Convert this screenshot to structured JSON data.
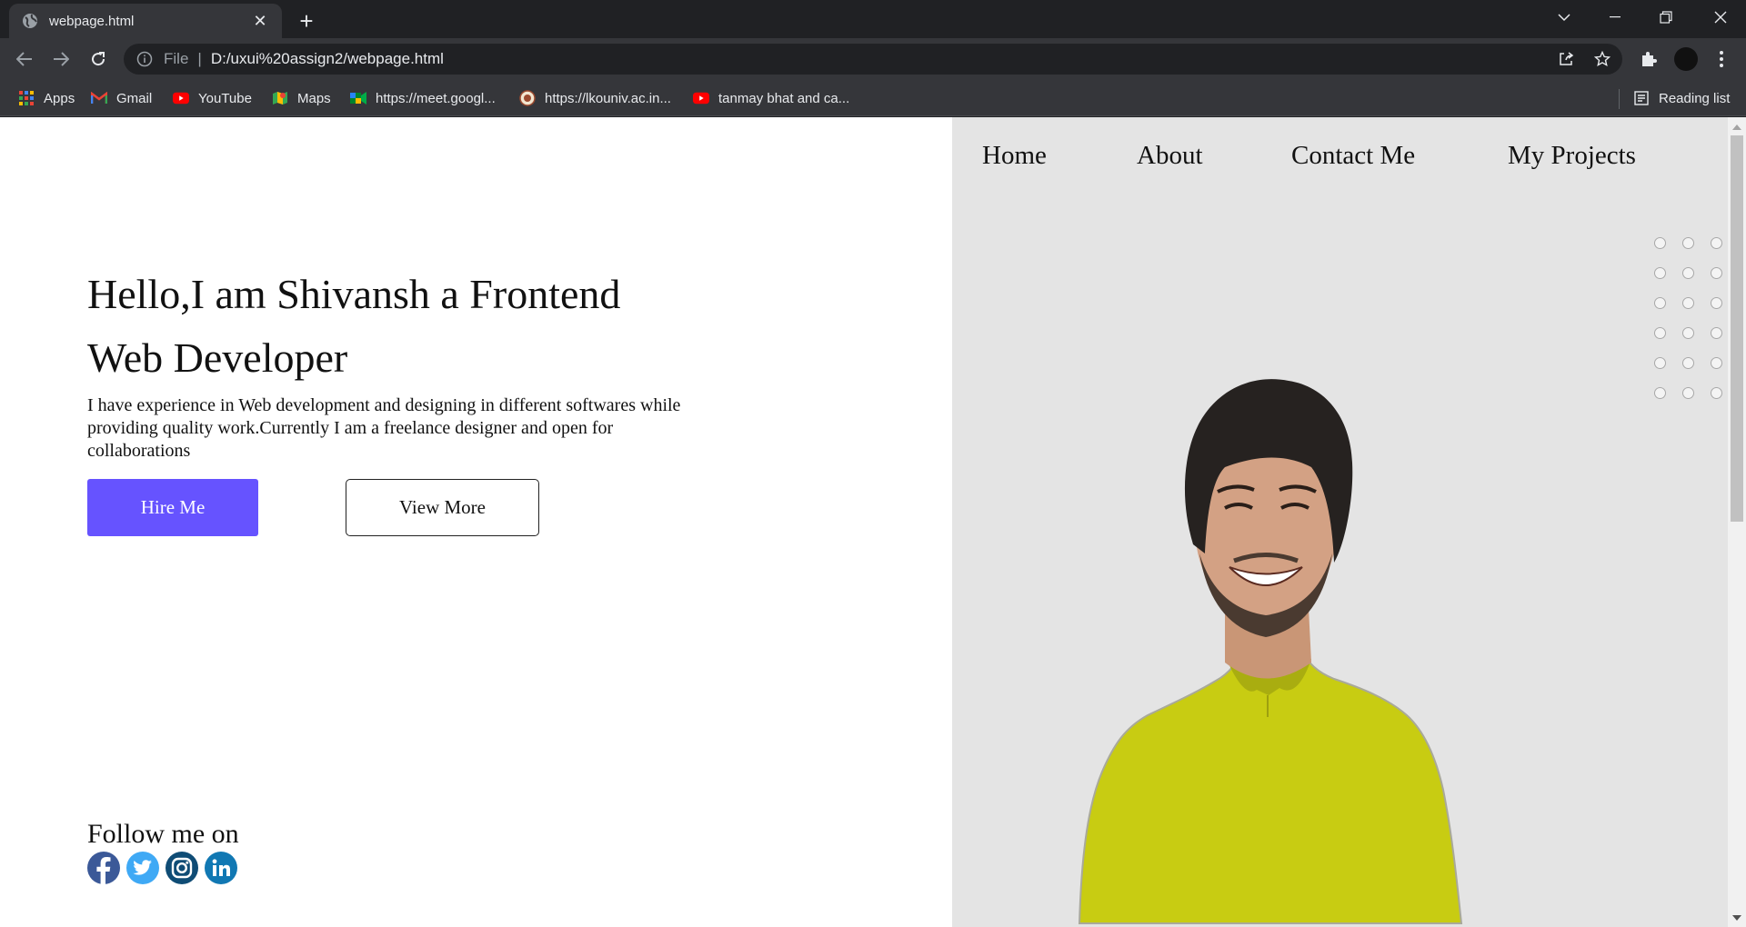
{
  "browser": {
    "tab_title": "webpage.html",
    "url_scheme": "File",
    "url": "D:/uxui%20assign2/webpage.html",
    "bookmarks": [
      {
        "label": "Apps",
        "icon": "apps-grid-icon"
      },
      {
        "label": "Gmail",
        "icon": "gmail-icon"
      },
      {
        "label": "YouTube",
        "icon": "youtube-icon"
      },
      {
        "label": "Maps",
        "icon": "maps-icon"
      },
      {
        "label": "https://meet.googl...",
        "icon": "meet-icon"
      },
      {
        "label": "https://lkouniv.ac.in...",
        "icon": "university-seal-icon"
      },
      {
        "label": "tanmay bhat and ca...",
        "icon": "youtube-icon"
      }
    ],
    "reading_list": "Reading list"
  },
  "nav": {
    "home": "Home",
    "about": "About",
    "contact": "Contact Me",
    "projects": "My Projects"
  },
  "hero": {
    "headline": "Hello,I am Shivansh a Frontend Web Developer",
    "intro": "I have experience in Web development and designing in different softwares while providing quality work.Currently I am a freelance designer and open for collaborations",
    "hire_label": "Hire Me",
    "view_more_label": "View More"
  },
  "social": {
    "heading": "Follow me on",
    "networks": [
      "facebook-icon",
      "twitter-icon",
      "instagram-icon",
      "linkedin-icon"
    ]
  },
  "colors": {
    "accent": "#6653ff",
    "panel": "#e4e4e4",
    "shirt": "#c8cc12"
  }
}
